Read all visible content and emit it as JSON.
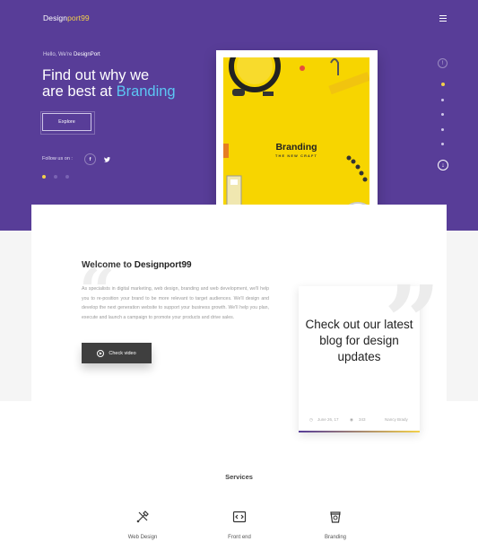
{
  "brand": {
    "logo_main": "Design",
    "logo_accent": "port99"
  },
  "colors": {
    "hero_bg": "#583d98",
    "accent_yellow": "#f3d14a",
    "accent_blue": "#5cc6f4",
    "dark_button": "#3f3f3f"
  },
  "hero": {
    "greeting_prefix": "Hello, We're ",
    "greeting_name": "DesignPort",
    "headline_line1": "Find out why we",
    "headline_line2": "are best at ",
    "headline_keyword": "Branding",
    "explore_label": "Explore",
    "follow_label": "Follow us on :",
    "social": [
      {
        "icon": "facebook-icon",
        "glyph": "f"
      },
      {
        "icon": "twitter-icon",
        "glyph": "✓"
      }
    ]
  },
  "slide_card": {
    "title": "Branding",
    "subtitle": "THE NEW CRAFT"
  },
  "side_nav": {
    "info_glyph": "!",
    "down_glyph": "↓"
  },
  "welcome": {
    "title_prefix": "Welcome to ",
    "title_brand": "Designport99",
    "body": "As specialists in digital marketing, web design, branding and web development, we'll help you to re-position your brand to be more relevant to target audiences. We'll design and develop the next generation website to support your business growth. We'll help you plan, execute and launch a campaign to promote your products and drive sales.",
    "video_label": "Check video"
  },
  "blog": {
    "text": "Check out our latest blog for design updates",
    "date": "June 26, 17",
    "views": "343",
    "author": "Nancy Brady"
  },
  "services": {
    "title": "Services",
    "items": [
      {
        "label": "Web Design",
        "icon": "web-design-icon"
      },
      {
        "label": "Front end",
        "icon": "code-icon"
      },
      {
        "label": "Branding",
        "icon": "cup-icon"
      }
    ]
  }
}
